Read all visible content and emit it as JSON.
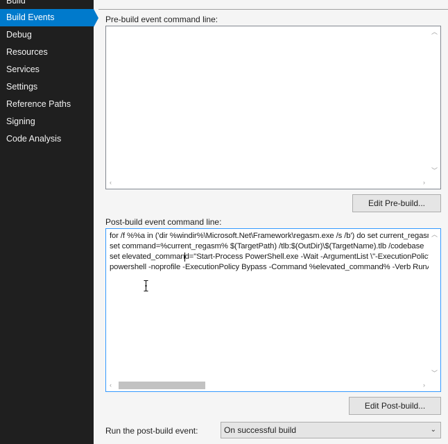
{
  "sidebar": {
    "items": [
      {
        "label": "Build"
      },
      {
        "label": "Build Events",
        "active": true
      },
      {
        "label": "Debug"
      },
      {
        "label": "Resources"
      },
      {
        "label": "Services"
      },
      {
        "label": "Settings"
      },
      {
        "label": "Reference Paths"
      },
      {
        "label": "Signing"
      },
      {
        "label": "Code Analysis"
      }
    ]
  },
  "prebuild": {
    "label": "Pre-build event command line:",
    "value": "",
    "edit_button": "Edit Pre-build..."
  },
  "postbuild": {
    "label": "Post-build event command line:",
    "lines": [
      "for /f %%a in ('dir %windir%\\Microsoft.Net\\Framework\\regasm.exe /s /b') do set current_regasm=\"%%a\"",
      "set command=%current_regasm% $(TargetPath) /tlb:$(OutDir)\\$(TargetName).tlb /codebase",
      "set elevated_command=\"Start-Process PowerShell.exe -Wait -ArgumentList \\\"-ExecutionPolicy",
      "powershell -noprofile -ExecutionPolicy Bypass -Command %elevated_command% -Verb RunAs"
    ],
    "edit_button": "Edit Post-build..."
  },
  "run_event": {
    "label": "Run the post-build event:",
    "selected": "On successful build"
  },
  "colors": {
    "sidebar_bg": "#1f1f1f",
    "accent": "#007acc",
    "focus_border": "#3399ff"
  }
}
